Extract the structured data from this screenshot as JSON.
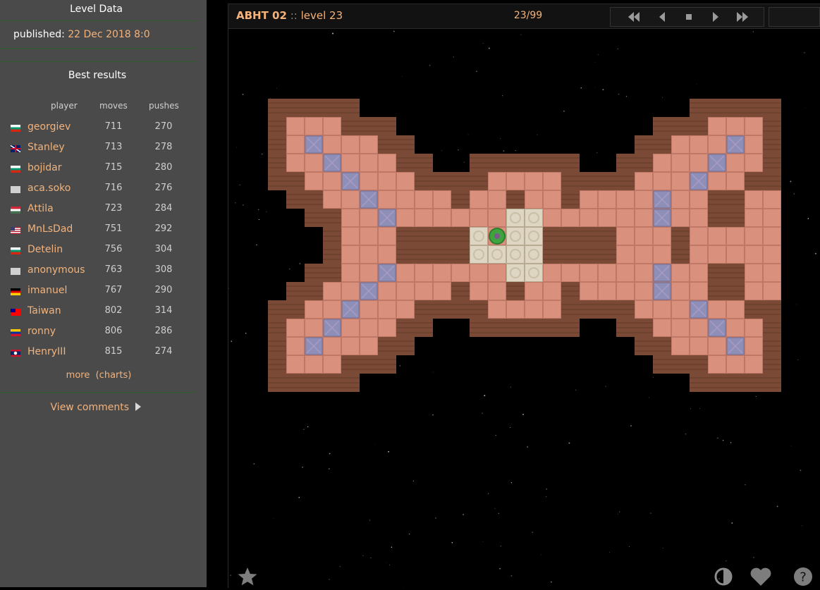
{
  "sidebar": {
    "level_data_title": "Level Data",
    "published_label": "published:",
    "published_date": "22 Dec 2018 8:0",
    "best_results_title": "Best results",
    "columns": {
      "player": "player",
      "moves": "moves",
      "pushes": "pushes"
    },
    "results": [
      {
        "player": "georgiev",
        "moves": "711",
        "pushes": "270",
        "flag": "bg"
      },
      {
        "player": "Stanley",
        "moves": "713",
        "pushes": "278",
        "flag": "gb"
      },
      {
        "player": "bojidar",
        "moves": "715",
        "pushes": "280",
        "flag": "bg"
      },
      {
        "player": "aca.soko",
        "moves": "716",
        "pushes": "276",
        "flag": "none"
      },
      {
        "player": "Attila",
        "moves": "723",
        "pushes": "284",
        "flag": "hu"
      },
      {
        "player": "MnLsDad",
        "moves": "751",
        "pushes": "292",
        "flag": "us"
      },
      {
        "player": "Detelin",
        "moves": "756",
        "pushes": "304",
        "flag": "bg"
      },
      {
        "player": "anonymous",
        "moves": "763",
        "pushes": "308",
        "flag": "none"
      },
      {
        "player": "imanuel",
        "moves": "767",
        "pushes": "290",
        "flag": "de"
      },
      {
        "player": "Taiwan",
        "moves": "802",
        "pushes": "314",
        "flag": "tw"
      },
      {
        "player": "ronny",
        "moves": "806",
        "pushes": "286",
        "flag": "ve"
      },
      {
        "player": "HenryIII",
        "moves": "815",
        "pushes": "274",
        "flag": "la"
      }
    ],
    "more_label": "more",
    "charts_label": "(charts)",
    "view_comments_label": "View comments"
  },
  "game": {
    "collection": "ABHT 02",
    "separator": "::",
    "level_label": "level 23",
    "counter": "23/99",
    "nav_icons": [
      "first-level-icon",
      "previous-level-icon",
      "stop-icon",
      "next-level-icon",
      "last-level-icon"
    ],
    "bottom_icons": [
      "star-icon",
      "contrast-icon",
      "heart-icon",
      "help-icon"
    ],
    "colors": {
      "accent": "#f3b37b",
      "wall": "#7a4a36",
      "floor": "#d9907c",
      "goal_floor": "#ded5c2",
      "box": "#8d8fb8",
      "player": "#3fa33f"
    }
  },
  "level_map": [
    "#####                  #####",
    "#   ###              ###   #",
    "# $   ##            ##   $ #",
    "#  $   ##  ######  ##   $  #",
    "##  $   ####    ####   $  ##",
    " ##  $    #  #  #    $  ## ",
    "  ##  $      ..      $  ## ",
    "   #   ####.@..####   #   ",
    "   #   ####....####   #   ",
    "  ##  $      ..      $  ## ",
    " ##  $    #  #  #    $  ## ",
    "##  $   ####    ####   $  ##",
    "#  $   ##  ######  ##   $  #",
    "# $   ##            ##   $ #",
    "#   ###              ###   #",
    "#####                  #####"
  ]
}
